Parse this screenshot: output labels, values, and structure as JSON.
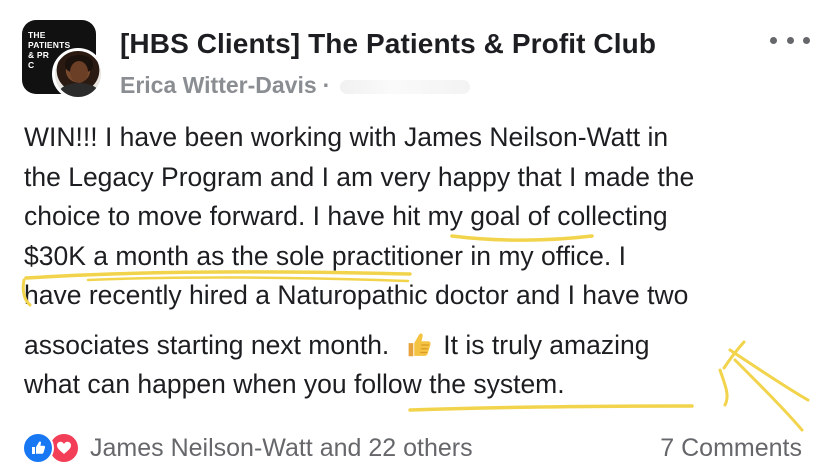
{
  "post": {
    "group_icon_text": "THE\nPATIENTS\n& PR\nC",
    "group_name": "[HBS Clients] The Patients & Profit Club",
    "author_name": "Erica Witter-Davis",
    "author_separator": "·",
    "more_icon": "more-horizontal-icon",
    "body_lines": [
      "WIN!!! I have been working with James Neilson-Watt in",
      "the Legacy Program and I am very happy that I made the",
      "choice to move forward.  I have hit my goal of collecting",
      "$30K a month as the sole practitioner in my office.  I",
      "have recently hired a Naturopathic doctor and I have two",
      "associates starting next month.",
      "It is truly amazing",
      "what can happen when you follow the system."
    ],
    "emoji": "thumbs-up-emoji",
    "highlight_color": "#f2d44c"
  },
  "footer": {
    "like_icon": "thumbs-up-icon",
    "love_icon": "heart-icon",
    "reactors": "James Neilson-Watt and 22 others",
    "comments": "7 Comments"
  },
  "colors": {
    "text": "#1c1e21",
    "secondary_text": "#65676b",
    "like_blue": "#1877f2",
    "love_red": "#f33e58"
  }
}
